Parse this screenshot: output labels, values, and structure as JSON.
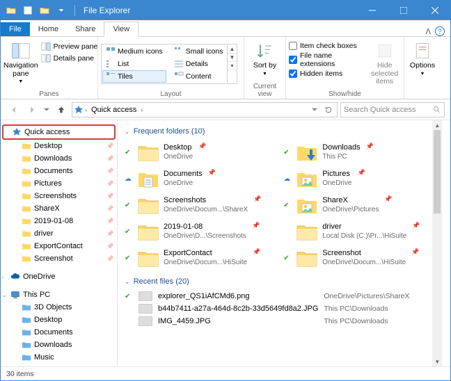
{
  "window": {
    "title": "File Explorer"
  },
  "tabs": {
    "file": "File",
    "home": "Home",
    "share": "Share",
    "view": "View"
  },
  "ribbon": {
    "panes": {
      "group": "Panes",
      "navigation": "Navigation pane",
      "preview": "Preview pane",
      "details": "Details pane"
    },
    "layout": {
      "group": "Layout",
      "medium": "Medium icons",
      "small": "Small icons",
      "list": "List",
      "details": "Details",
      "tiles": "Tiles",
      "content": "Content"
    },
    "currentview": {
      "group": "Current view",
      "sort": "Sort by"
    },
    "showhide": {
      "group": "Show/hide",
      "itemcheck": "Item check boxes",
      "fileext": "File name extensions",
      "hidden": "Hidden items",
      "hidesel": "Hide selected items"
    },
    "options": "Options"
  },
  "breadcrumb": {
    "root": "Quick access"
  },
  "search": {
    "placeholder": "Search Quick access"
  },
  "nav": {
    "quick": "Quick access",
    "items": [
      "Desktop",
      "Downloads",
      "Documents",
      "Pictures",
      "Screenshots",
      "ShareX",
      "2019-01-08",
      "driver",
      "ExportContact",
      "Screenshot"
    ],
    "onedrive": "OneDrive",
    "thispc": "This PC",
    "pc_items": [
      "3D Objects",
      "Desktop",
      "Documents",
      "Downloads",
      "Music"
    ]
  },
  "sections": {
    "frequent": {
      "title": "Frequent folders (10)"
    },
    "recent": {
      "title": "Recent files (20)"
    }
  },
  "folders": [
    {
      "name": "Desktop",
      "loc": "OneDrive",
      "sync": "ok",
      "pin": true
    },
    {
      "name": "Downloads",
      "loc": "This PC",
      "sync": "ok",
      "pin": true,
      "icon": "dl"
    },
    {
      "name": "Documents",
      "loc": "OneDrive",
      "sync": "cloud",
      "pin": true,
      "icon": "doc"
    },
    {
      "name": "Pictures",
      "loc": "OneDrive",
      "sync": "cloud",
      "pin": true,
      "icon": "pic"
    },
    {
      "name": "Screenshots",
      "loc": "OneDrive\\Docum...\\ShareX",
      "sync": "ok",
      "pin": true
    },
    {
      "name": "ShareX",
      "loc": "OneDrive\\Pictures",
      "sync": "ok",
      "pin": true,
      "icon": "pic"
    },
    {
      "name": "2019-01-08",
      "loc": "OneDrive\\D...\\Screenshots",
      "sync": "ok",
      "pin": true
    },
    {
      "name": "driver",
      "loc": "Local Disk (C:)\\Pr...\\HiSuite",
      "sync": "",
      "pin": true
    },
    {
      "name": "ExportContact",
      "loc": "OneDrive\\Docum...\\HiSuite",
      "sync": "ok",
      "pin": true
    },
    {
      "name": "Screenshot",
      "loc": "OneDrive\\Docum...\\HiSuite",
      "sync": "ok",
      "pin": true
    }
  ],
  "files": [
    {
      "name": "explorer_QS1iAfCMd6.png",
      "loc": "OneDrive\\Pictures\\ShareX",
      "sync": "ok"
    },
    {
      "name": "b44b7411-a27a-464d-8c2b-33d5649fd8a2.JPG",
      "loc": "This PC\\Downloads",
      "sync": ""
    },
    {
      "name": "IMG_4459.JPG",
      "loc": "This PC\\Downloads",
      "sync": ""
    }
  ],
  "status": {
    "count": "30 items"
  }
}
